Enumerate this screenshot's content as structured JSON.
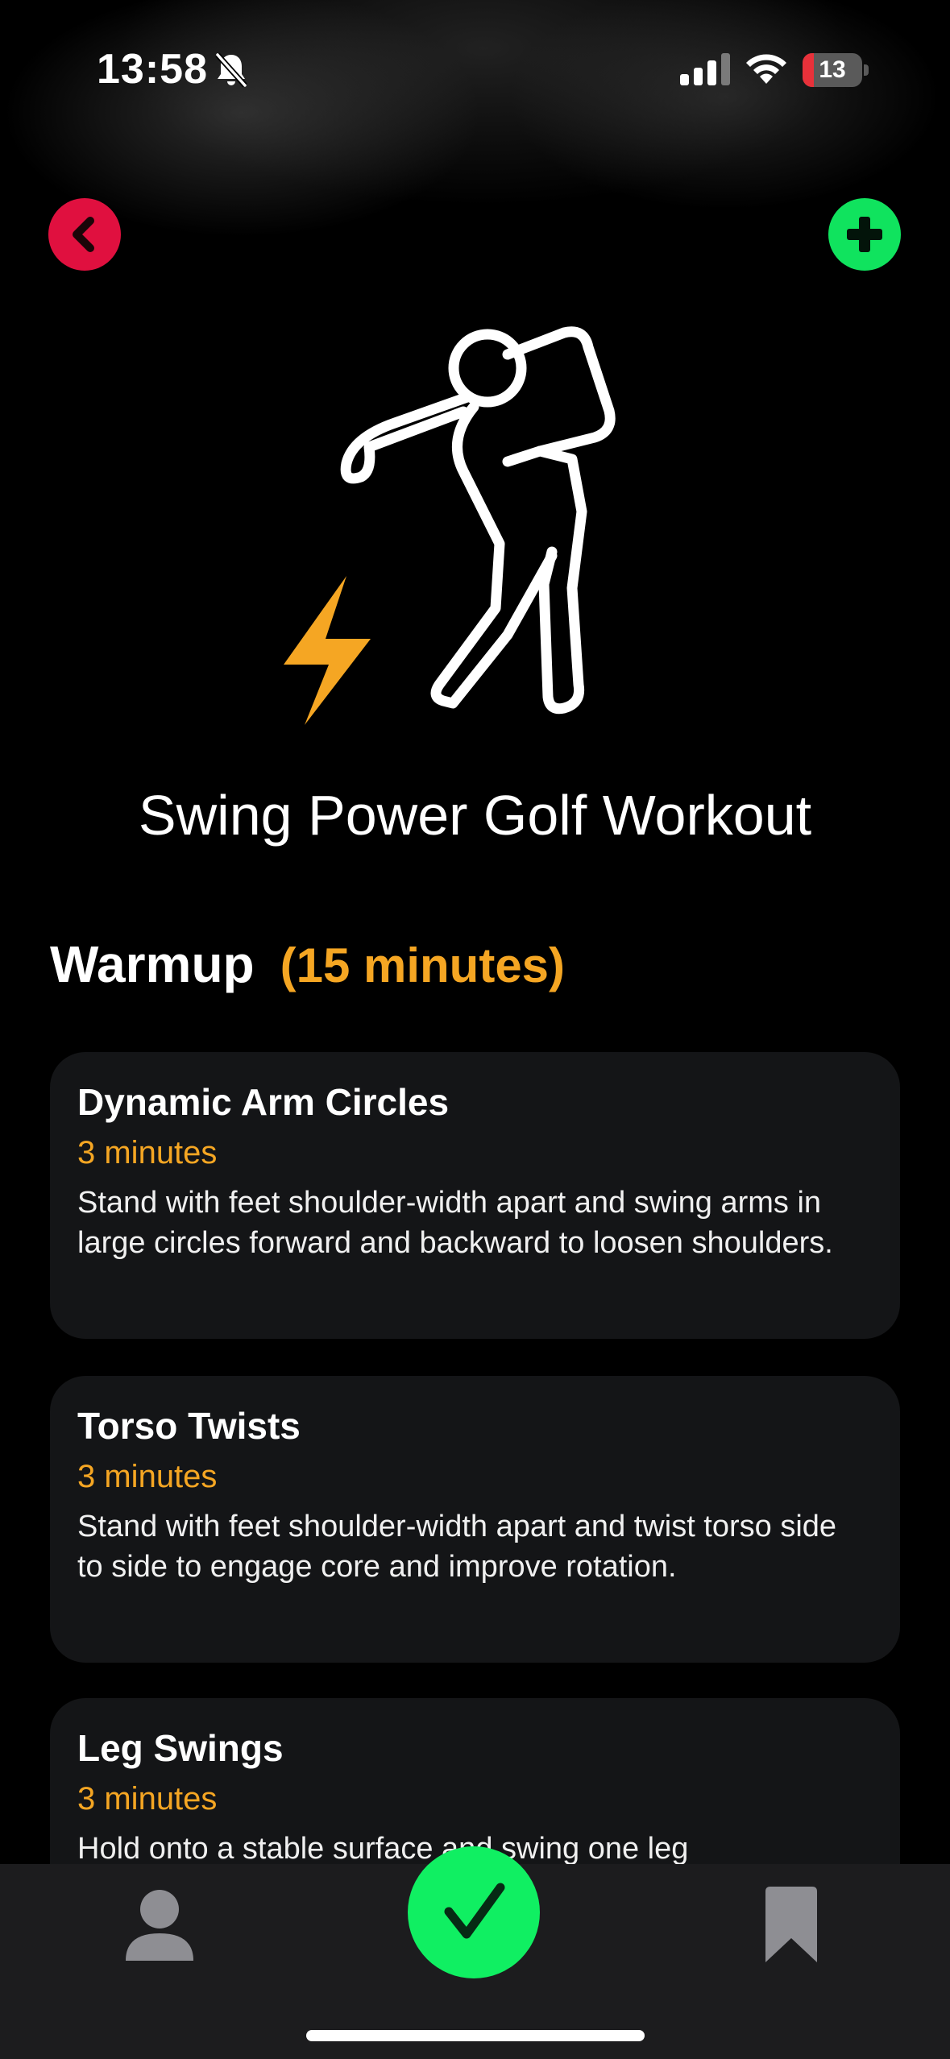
{
  "status_bar": {
    "time": "13:58",
    "battery_level": "13",
    "battery_fraction": 0.13,
    "icons": [
      "bell-slash-icon",
      "cellular-signal-icon",
      "wifi-icon",
      "battery-icon"
    ]
  },
  "header": {
    "back_icon": "chevron-left-icon",
    "add_icon": "plus-icon"
  },
  "hero": {
    "icons": [
      "golfer-icon",
      "lightning-bolt-icon"
    ]
  },
  "workout": {
    "title": "Swing Power Golf Workout"
  },
  "section": {
    "title": "Warmup",
    "duration": "(15 minutes)"
  },
  "exercises": [
    {
      "title": "Dynamic Arm Circles",
      "duration": "3 minutes",
      "description": "Stand with feet shoulder-width apart and swing arms in large circles forward and backward to loosen shoulders."
    },
    {
      "title": "Torso Twists",
      "duration": "3 minutes",
      "description": "Stand with feet shoulder-width apart and twist torso side to side to engage core and improve rotation."
    },
    {
      "title": "Leg Swings",
      "duration": "3 minutes",
      "description": "Hold onto a stable surface and swing one leg"
    }
  ],
  "tab_bar": {
    "items": [
      "person-icon",
      "checkmark-icon",
      "bookmark-icon"
    ]
  },
  "colors": {
    "accent_orange": "#f5a623",
    "back_red": "#e0103f",
    "add_green": "#10e35e",
    "check_green": "#10ef62",
    "card_bg": "#141517",
    "tab_bar_bg": "#1c1c1e"
  }
}
